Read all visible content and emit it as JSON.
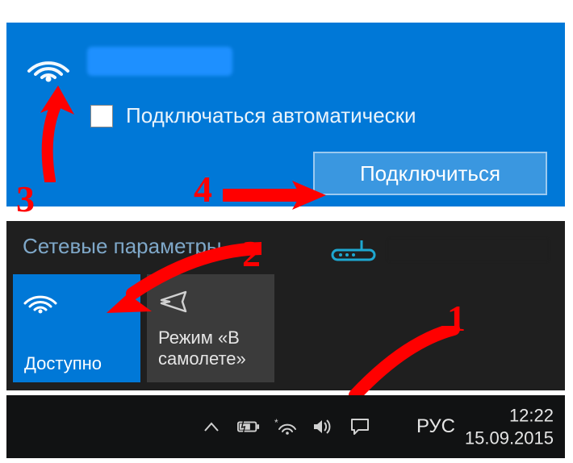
{
  "network_panel": {
    "auto_connect_label": "Подключаться автоматически",
    "connect_button_label": "Подключиться"
  },
  "markers": {
    "m1": "1",
    "m2": "2",
    "m3": "3",
    "m4": "4"
  },
  "network_flyout": {
    "settings_label": "Сетевые параметры",
    "wifi_tile_label": "Доступно",
    "airplane_tile_label": "Режим «В самолете»"
  },
  "taskbar": {
    "language": "РУС",
    "time": "12:22",
    "date": "15.09.2015"
  }
}
